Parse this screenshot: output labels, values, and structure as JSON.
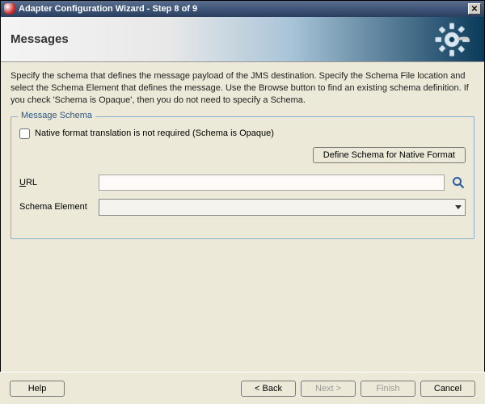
{
  "window": {
    "title": "Adapter Configuration Wizard - Step 8 of 9"
  },
  "banner": {
    "heading": "Messages"
  },
  "instructions": "Specify the schema that defines the message payload of the JMS destination.  Specify the Schema File location and select the Schema Element that defines the message. Use the Browse button to find an existing schema definition. If you check 'Schema is Opaque', then you do not need to specify a Schema.",
  "group": {
    "legend": "Message Schema",
    "opaque_label": "Native format translation is not required (Schema is Opaque)",
    "define_btn": "Define Schema for Native Format",
    "url_label": "URL",
    "url_value": "",
    "schema_element_label": "Schema Element",
    "schema_element_value": ""
  },
  "footer": {
    "help": "Help",
    "back": "< Back",
    "next": "Next >",
    "finish": "Finish",
    "cancel": "Cancel"
  }
}
